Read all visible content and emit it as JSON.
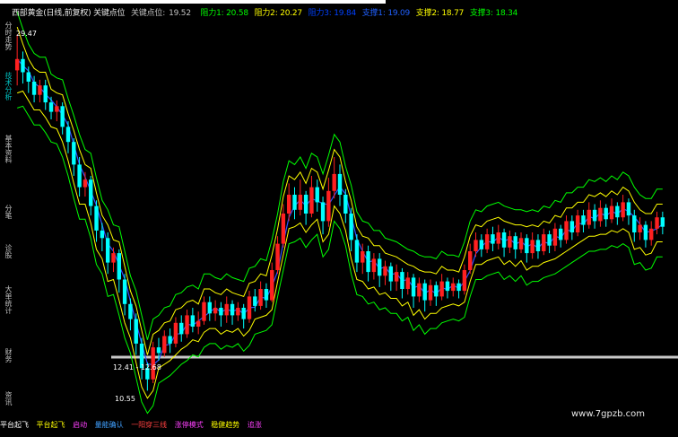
{
  "header": {
    "title": "西部黄金(日线,前复权) 关键点位",
    "key_label": "关键点位:",
    "key_value": "19.52",
    "r1": "阻力1: 20.58",
    "r2": "阻力2: 20.27",
    "r3": "阻力3: 19.84",
    "s1": "支撑1: 19.09",
    "s2": "支撑2: 18.77",
    "s3": "支撑3: 18.34",
    "colors": {
      "title": "#e8e8e8",
      "key": "#c0c0c0",
      "r1": "#00ff00",
      "r2": "#ffff00",
      "r3": "#0040ff",
      "s1": "#2060ff",
      "s2": "#ffff00",
      "s3": "#00ff00"
    }
  },
  "sidebar": {
    "tabs": [
      {
        "label": "分时走势",
        "color": "#c0c0c0"
      },
      {
        "label": "技术分析",
        "color": "#00c0c0"
      },
      {
        "label": "基本资料",
        "color": "#c0c0c0"
      },
      {
        "label": "分笔",
        "color": "#c0c0c0"
      },
      {
        "label": "诊股",
        "color": "#c0c0c0"
      },
      {
        "label": "大单统计",
        "color": "#c0c0c0"
      },
      {
        "label": "财务",
        "color": "#c0c0c0"
      },
      {
        "label": "资讯",
        "color": "#c0c0c0"
      }
    ]
  },
  "footer": {
    "items": [
      {
        "label": "平台起飞",
        "color": "#ffffff"
      },
      {
        "label": "平台起飞",
        "color": "#ffff00"
      },
      {
        "label": "启动",
        "color": "#ff40ff"
      },
      {
        "label": "量能确认",
        "color": "#40a0ff"
      },
      {
        "label": "一阳穿三线",
        "color": "#ff4040"
      },
      {
        "label": "涨停模式",
        "color": "#ff40ff"
      },
      {
        "label": "稳健趋势",
        "color": "#ffff00"
      },
      {
        "label": "追涨",
        "color": "#ff40ff"
      }
    ]
  },
  "watermark": "www.7gpzb.com",
  "chart_data": {
    "type": "candlestick",
    "title": "西部黄金(日线,前复权)",
    "annotations": [
      {
        "text": "29.47",
        "at": "high"
      },
      {
        "text": "12.41 - 12.68",
        "at": "gap"
      },
      {
        "text": "10.55",
        "at": "low"
      }
    ],
    "ylim": [
      10,
      30
    ],
    "colors": {
      "up": "#ff2020",
      "down": "#00ffff",
      "band_outer": "#00ff00",
      "band_inner": "#ffff00",
      "ma": "#3050ff",
      "bg": "#000000",
      "level": "#c8c8c8"
    },
    "candles": [
      [
        27.6,
        28.2,
        26.8,
        29.5
      ],
      [
        28.2,
        27.5,
        26.9,
        28.6
      ],
      [
        27.5,
        27.0,
        26.4,
        27.8
      ],
      [
        27.0,
        26.3,
        25.9,
        27.3
      ],
      [
        26.3,
        26.8,
        25.9,
        27.1
      ],
      [
        26.8,
        25.9,
        25.5,
        27.1
      ],
      [
        25.9,
        25.4,
        25.0,
        26.2
      ],
      [
        25.4,
        25.7,
        24.9,
        26.0
      ],
      [
        25.7,
        24.6,
        24.2,
        25.9
      ],
      [
        24.6,
        23.8,
        23.2,
        24.9
      ],
      [
        23.8,
        22.6,
        22.0,
        24.0
      ],
      [
        22.6,
        21.4,
        20.9,
        23.0
      ],
      [
        21.4,
        21.8,
        20.9,
        22.2
      ],
      [
        21.8,
        20.4,
        19.9,
        22.0
      ],
      [
        20.4,
        19.1,
        18.5,
        20.7
      ],
      [
        19.1,
        18.7,
        18.0,
        19.5
      ],
      [
        18.7,
        17.4,
        16.8,
        19.0
      ],
      [
        17.4,
        17.9,
        16.9,
        18.2
      ],
      [
        17.9,
        16.5,
        15.8,
        18.1
      ],
      [
        16.5,
        15.2,
        14.6,
        16.8
      ],
      [
        15.2,
        14.4,
        13.8,
        15.5
      ],
      [
        14.4,
        13.1,
        12.5,
        14.7
      ],
      [
        13.1,
        11.8,
        11.2,
        13.4
      ],
      [
        11.8,
        11.2,
        10.6,
        12.1
      ],
      [
        11.2,
        12.9,
        11.0,
        13.2
      ],
      [
        12.9,
        12.6,
        12.2,
        13.4
      ],
      [
        12.6,
        13.5,
        12.4,
        13.8
      ],
      [
        13.5,
        13.1,
        12.6,
        13.9
      ],
      [
        13.1,
        14.2,
        12.9,
        14.5
      ],
      [
        14.2,
        13.6,
        13.2,
        14.6
      ],
      [
        13.6,
        14.6,
        13.4,
        14.9
      ],
      [
        14.6,
        14.0,
        13.7,
        15.0
      ],
      [
        14.0,
        14.3,
        13.6,
        14.8
      ],
      [
        14.3,
        15.3,
        14.1,
        15.6
      ],
      [
        15.3,
        14.7,
        14.3,
        15.6
      ],
      [
        14.7,
        15.0,
        14.3,
        15.4
      ],
      [
        15.0,
        14.6,
        14.0,
        15.3
      ],
      [
        14.6,
        15.2,
        14.2,
        15.6
      ],
      [
        15.2,
        14.6,
        14.1,
        15.4
      ],
      [
        14.6,
        15.0,
        14.3,
        15.3
      ],
      [
        15.0,
        14.4,
        13.9,
        15.2
      ],
      [
        14.4,
        15.6,
        14.2,
        15.9
      ],
      [
        15.6,
        15.1,
        14.8,
        16.0
      ],
      [
        15.1,
        16.0,
        14.9,
        16.4
      ],
      [
        16.0,
        15.4,
        15.0,
        16.3
      ],
      [
        15.4,
        17.0,
        15.3,
        17.4
      ],
      [
        17.0,
        18.4,
        16.8,
        18.8
      ],
      [
        18.4,
        20.0,
        18.2,
        20.5
      ],
      [
        20.0,
        21.0,
        19.6,
        21.6
      ],
      [
        21.0,
        20.2,
        19.7,
        21.4
      ],
      [
        20.2,
        21.0,
        19.9,
        21.8
      ],
      [
        21.0,
        20.0,
        19.4,
        21.2
      ],
      [
        20.0,
        21.4,
        19.8,
        22.0
      ],
      [
        21.4,
        20.6,
        20.1,
        21.8
      ],
      [
        20.6,
        19.6,
        18.9,
        20.9
      ],
      [
        19.6,
        21.2,
        19.3,
        21.9
      ],
      [
        21.2,
        22.1,
        20.8,
        23.0
      ],
      [
        22.1,
        21.0,
        20.4,
        22.6
      ],
      [
        21.0,
        20.0,
        19.5,
        21.3
      ],
      [
        20.0,
        18.6,
        18.0,
        20.3
      ],
      [
        18.6,
        17.4,
        16.9,
        18.9
      ],
      [
        17.4,
        18.0,
        16.8,
        18.4
      ],
      [
        18.0,
        16.9,
        16.4,
        18.3
      ],
      [
        16.9,
        17.6,
        16.5,
        17.9
      ],
      [
        17.6,
        16.7,
        16.1,
        17.9
      ],
      [
        16.7,
        17.2,
        16.2,
        17.5
      ],
      [
        17.2,
        16.4,
        15.9,
        17.4
      ],
      [
        16.4,
        16.9,
        15.9,
        17.3
      ],
      [
        16.9,
        16.0,
        15.5,
        17.1
      ],
      [
        16.0,
        16.6,
        15.7,
        16.9
      ],
      [
        16.6,
        15.6,
        15.0,
        16.8
      ],
      [
        15.6,
        16.3,
        15.3,
        16.6
      ],
      [
        16.3,
        15.4,
        14.8,
        16.5
      ],
      [
        15.4,
        16.2,
        15.1,
        16.5
      ],
      [
        16.2,
        15.6,
        15.1,
        16.4
      ],
      [
        15.6,
        16.4,
        15.4,
        16.8
      ],
      [
        16.4,
        15.9,
        15.5,
        16.6
      ],
      [
        15.9,
        16.3,
        15.6,
        16.6
      ],
      [
        16.3,
        15.9,
        15.5,
        16.5
      ],
      [
        15.9,
        17.0,
        15.7,
        17.3
      ],
      [
        17.0,
        18.0,
        16.8,
        18.4
      ],
      [
        18.0,
        18.6,
        17.7,
        19.0
      ],
      [
        18.6,
        18.1,
        17.7,
        18.9
      ],
      [
        18.1,
        18.9,
        17.9,
        19.2
      ],
      [
        18.9,
        18.4,
        18.0,
        19.3
      ],
      [
        18.4,
        19.0,
        18.1,
        19.4
      ],
      [
        19.0,
        18.2,
        17.7,
        19.2
      ],
      [
        18.2,
        18.8,
        17.9,
        19.1
      ],
      [
        18.8,
        18.1,
        17.6,
        19.0
      ],
      [
        18.1,
        18.7,
        17.9,
        19.0
      ],
      [
        18.7,
        17.9,
        17.4,
        18.9
      ],
      [
        17.9,
        18.6,
        17.6,
        19.0
      ],
      [
        18.6,
        18.0,
        17.6,
        18.9
      ],
      [
        18.0,
        18.9,
        17.8,
        19.2
      ],
      [
        18.9,
        18.3,
        17.9,
        19.1
      ],
      [
        18.3,
        19.2,
        18.0,
        19.5
      ],
      [
        19.2,
        18.6,
        18.2,
        19.4
      ],
      [
        18.6,
        19.6,
        18.4,
        19.9
      ],
      [
        19.6,
        19.0,
        18.6,
        19.9
      ],
      [
        19.0,
        19.9,
        18.8,
        20.2
      ],
      [
        19.9,
        19.4,
        19.0,
        20.2
      ],
      [
        19.4,
        20.2,
        19.2,
        20.6
      ],
      [
        20.2,
        19.6,
        19.2,
        20.5
      ],
      [
        19.6,
        20.3,
        19.3,
        20.7
      ],
      [
        20.3,
        19.7,
        19.3,
        20.5
      ],
      [
        19.7,
        20.4,
        19.5,
        20.8
      ],
      [
        20.4,
        19.8,
        19.4,
        20.6
      ],
      [
        19.8,
        20.6,
        19.6,
        21.0
      ],
      [
        20.6,
        19.9,
        19.4,
        20.8
      ],
      [
        19.9,
        19.0,
        18.5,
        20.2
      ],
      [
        19.0,
        19.4,
        18.6,
        19.8
      ],
      [
        19.4,
        18.6,
        18.2,
        19.6
      ],
      [
        18.6,
        19.2,
        18.3,
        19.6
      ],
      [
        19.2,
        19.8,
        18.9,
        20.1
      ],
      [
        19.8,
        19.3,
        18.9,
        20.1
      ]
    ]
  }
}
